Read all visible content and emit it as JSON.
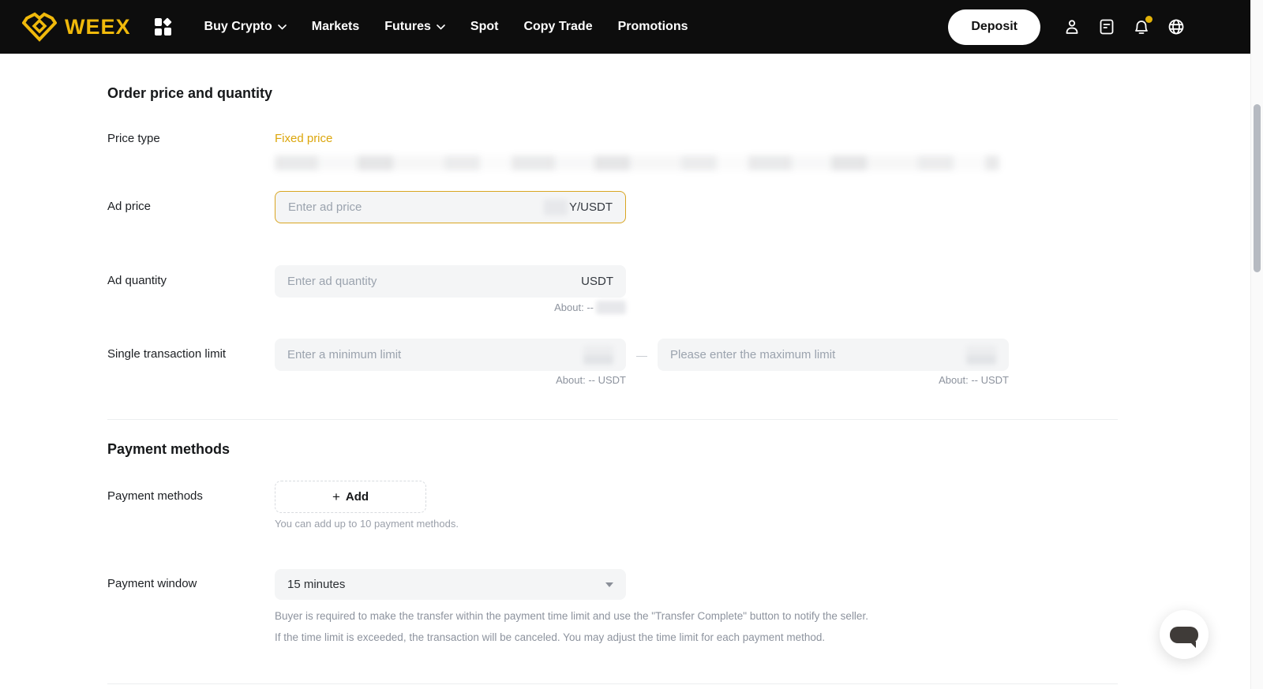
{
  "colors": {
    "accent_gold": "#F0B90B",
    "fixed_price_text": "#DCA60B",
    "nav_bg": "#0D0D0D",
    "input_bg": "#F4F5F6",
    "muted_text": "#8D939E",
    "bell_badge": "#E3B208"
  },
  "nav": {
    "brand": "WEEX",
    "items": [
      {
        "label": "Buy Crypto"
      },
      {
        "label": "Markets"
      },
      {
        "label": "Futures"
      },
      {
        "label": "Spot"
      },
      {
        "label": "Copy Trade"
      },
      {
        "label": "Promotions"
      }
    ],
    "deposit_label": "Deposit"
  },
  "order_section": {
    "title": "Order price and quantity",
    "price_type": {
      "label": "Price type",
      "value": "Fixed price"
    },
    "ad_price": {
      "label": "Ad price",
      "placeholder": "Enter ad price",
      "suffix_visible": "Y/USDT"
    },
    "ad_quantity": {
      "label": "Ad quantity",
      "placeholder": "Enter ad quantity",
      "suffix": "USDT",
      "about": "About: --"
    },
    "single_limit": {
      "label": "Single transaction limit",
      "min_placeholder": "Enter a minimum limit",
      "max_placeholder": "Please enter the maximum limit",
      "separator": "—",
      "min_about": "About: -- USDT",
      "max_about": "About: -- USDT"
    }
  },
  "payment_section": {
    "title": "Payment methods",
    "methods": {
      "label": "Payment methods",
      "add_plus": "+",
      "add_label": "Add",
      "hint": "You can add up to 10 payment methods."
    },
    "window": {
      "label": "Payment window",
      "value": "15 minutes",
      "note1": "Buyer is required to make the transfer within the payment time limit and use the \"Transfer Complete\" button to notify the seller.",
      "note2": "If the time limit is exceeded, the transaction will be canceled. You may adjust the time limit for each payment method."
    }
  }
}
